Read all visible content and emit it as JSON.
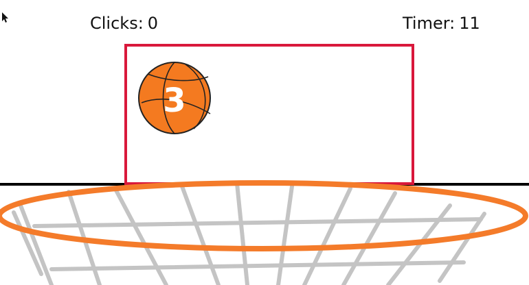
{
  "hud": {
    "clicks_label": "Clicks:",
    "clicks_value": "0",
    "timer_label": "Timer:",
    "timer_value": "11"
  },
  "ball": {
    "number": "3",
    "color": "#f47a20"
  },
  "colors": {
    "backboard_border": "#d9183b",
    "rim": "#f47b2a",
    "net": "#c4c4c4",
    "floor_line": "#000000"
  },
  "icons": {
    "cursor": "arrow-cursor-icon",
    "ball": "basketball-icon"
  }
}
